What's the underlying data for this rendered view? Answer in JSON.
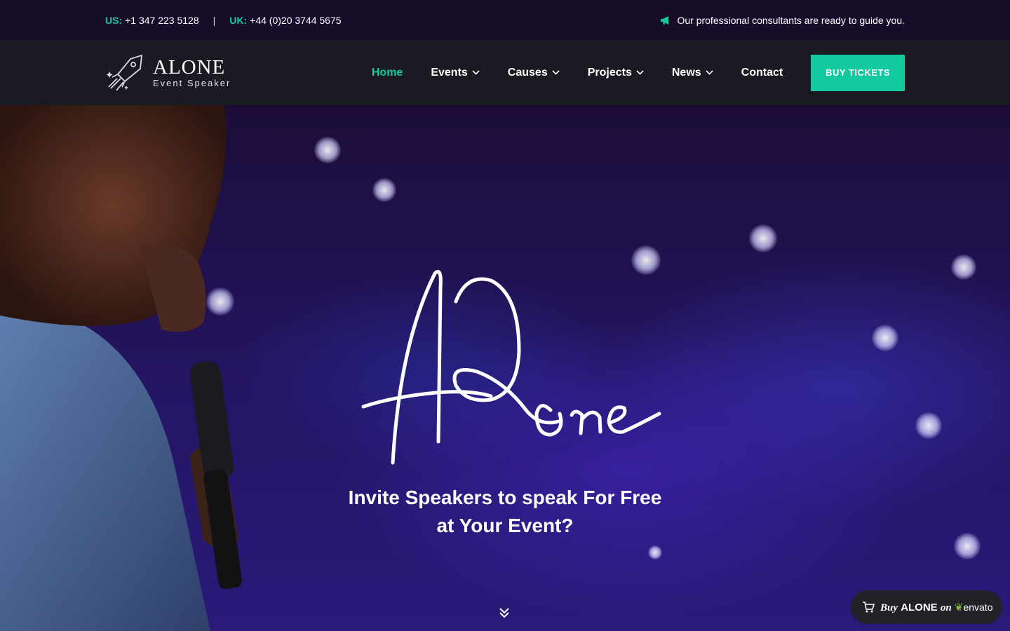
{
  "topbar": {
    "us_label": "US:",
    "us_phone": "+1 347 223 5128",
    "separator": "|",
    "uk_label": "UK:",
    "uk_phone": "+44 (0)20 3744 5675",
    "message": "Our professional consultants are ready to guide you.",
    "icon": "megaphone-icon"
  },
  "header": {
    "logo_name": "ALONE",
    "logo_tagline": "Event Speaker",
    "nav": [
      {
        "label": "Home",
        "active": true,
        "dropdown": false
      },
      {
        "label": "Events",
        "active": false,
        "dropdown": true
      },
      {
        "label": "Causes",
        "active": false,
        "dropdown": true
      },
      {
        "label": "Projects",
        "active": false,
        "dropdown": true
      },
      {
        "label": "News",
        "active": false,
        "dropdown": true
      },
      {
        "label": "Contact",
        "active": false,
        "dropdown": false
      }
    ],
    "cta_label": "BUY TICKETS"
  },
  "hero": {
    "script_title": "Alone",
    "headline_line1": "Invite Speakers to speak For Free",
    "headline_line2": "at Your Event?",
    "scroll_icon": "chevron-double-down-icon"
  },
  "envato_badge": {
    "buy": "Buy",
    "brand": "ALONE",
    "on": "on",
    "envato": "envato",
    "icon": "cart-icon"
  },
  "colors": {
    "accent": "#12c9a0",
    "topbar_bg": "#170d2b",
    "header_bg": "#191a22"
  }
}
